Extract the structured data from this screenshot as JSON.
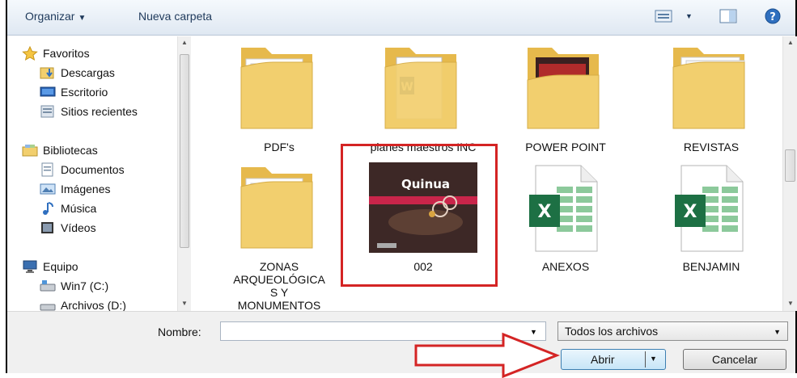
{
  "toolbar": {
    "organize_label": "Organizar",
    "new_folder_label": "Nueva carpeta"
  },
  "nav": {
    "favorites_header": "Favoritos",
    "favorites": [
      {
        "label": "Descargas",
        "icon": "downloads-icon"
      },
      {
        "label": "Escritorio",
        "icon": "desktop-icon"
      },
      {
        "label": "Sitios recientes",
        "icon": "recent-places-icon"
      }
    ],
    "libraries_header": "Bibliotecas",
    "libraries": [
      {
        "label": "Documentos",
        "icon": "documents-icon"
      },
      {
        "label": "Imágenes",
        "icon": "pictures-icon"
      },
      {
        "label": "Música",
        "icon": "music-icon"
      },
      {
        "label": "Vídeos",
        "icon": "videos-icon"
      }
    ],
    "computer_header": "Equipo",
    "computer": [
      {
        "label": "Win7 (C:)",
        "icon": "drive-icon"
      },
      {
        "label": "Archivos (D:)",
        "icon": "drive-icon"
      }
    ]
  },
  "files": {
    "pdfs": "PDF's",
    "planes": "planes maestros INC",
    "powerpoint": "POWER POINT",
    "revistas": "REVISTAS",
    "zonas": "ZONAS ARQUEOLÓGICAS Y MONUMENTOS",
    "zonas_lines": [
      "ZONAS",
      "ARQUEOLÓGICA",
      "S Y",
      "MONUMENTOS"
    ],
    "f002": "002",
    "anexos": "ANEXOS",
    "benjamin": "BENJAMIN",
    "quinua_title": "Quinua"
  },
  "bottom": {
    "name_label": "Nombre:",
    "name_value": "",
    "file_type": "Todos los archivos",
    "open_label": "Abrir",
    "cancel_label": "Cancelar"
  },
  "colors": {
    "highlight": "#d42424",
    "folder": "#f2cf6e",
    "excel": "#1d7044"
  }
}
